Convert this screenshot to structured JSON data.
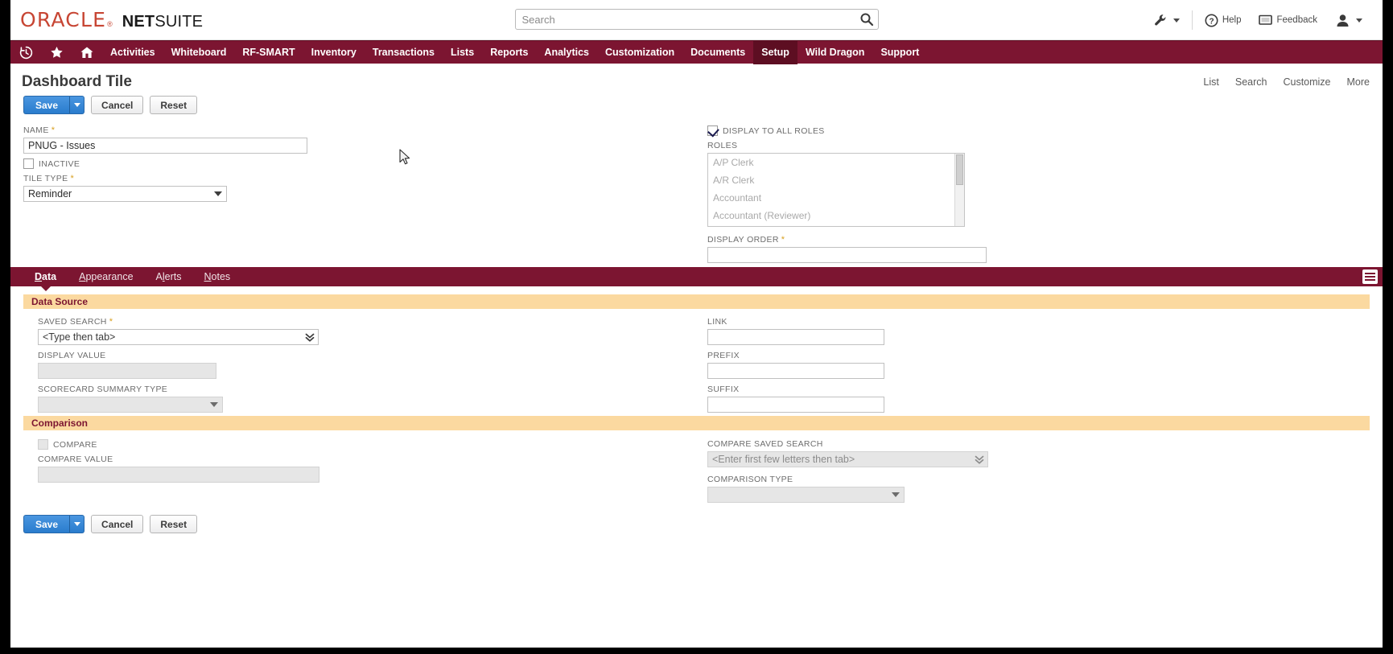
{
  "brand": {
    "oracle": "ORACLE",
    "netsuite_bold": "NET",
    "netsuite_light": "SUITE"
  },
  "search": {
    "placeholder": "Search",
    "value": "",
    "icon": "search-icon"
  },
  "topbar_right": {
    "settings_icon": "wrench-settings-icon",
    "help_label": "Help",
    "help_icon": "question-circle-icon",
    "feedback_label": "Feedback",
    "feedback_icon": "speech-bubble-icon",
    "avatar_icon": "user-avatar-icon"
  },
  "nav": {
    "icons": [
      "recent-records-icon",
      "shortcuts-star-icon",
      "home-icon"
    ],
    "items": [
      {
        "label": "Activities",
        "active": false
      },
      {
        "label": "Whiteboard",
        "active": false
      },
      {
        "label": "RF-SMART",
        "active": false
      },
      {
        "label": "Inventory",
        "active": false
      },
      {
        "label": "Transactions",
        "active": false
      },
      {
        "label": "Lists",
        "active": false
      },
      {
        "label": "Reports",
        "active": false
      },
      {
        "label": "Analytics",
        "active": false
      },
      {
        "label": "Customization",
        "active": false
      },
      {
        "label": "Documents",
        "active": false
      },
      {
        "label": "Setup",
        "active": true
      },
      {
        "label": "Wild Dragon",
        "active": false
      },
      {
        "label": "Support",
        "active": false
      }
    ]
  },
  "page": {
    "title": "Dashboard Tile",
    "links": [
      "List",
      "Search",
      "Customize",
      "More"
    ]
  },
  "buttons": {
    "save": "Save",
    "cancel": "Cancel",
    "reset": "Reset"
  },
  "form": {
    "name_label": "NAME",
    "name_value": "PNUG - Issues",
    "inactive_label": "INACTIVE",
    "inactive_checked": false,
    "tile_type_label": "TILE TYPE",
    "tile_type_value": "Reminder",
    "display_all_roles_label": "DISPLAY TO ALL ROLES",
    "display_all_roles_checked": true,
    "roles_label": "ROLES",
    "roles": [
      "A/P Clerk",
      "A/R Clerk",
      "Accountant",
      "Accountant (Reviewer)"
    ],
    "display_order_label": "DISPLAY ORDER",
    "display_order_value": ""
  },
  "tabs": [
    {
      "label": "Data",
      "accesskey": "D",
      "active": true
    },
    {
      "label": "Appearance",
      "accesskey": "A",
      "active": false
    },
    {
      "label": "Alerts",
      "accesskey": "l",
      "active": false
    },
    {
      "label": "Notes",
      "accesskey": "N",
      "active": false
    }
  ],
  "data_source": {
    "header": "Data Source",
    "saved_search_label": "SAVED SEARCH",
    "saved_search_placeholder": "<Type then tab>",
    "saved_search_value": "",
    "display_value_label": "DISPLAY VALUE",
    "display_value": "",
    "scorecard_summary_label": "SCORECARD SUMMARY TYPE",
    "scorecard_summary_value": "",
    "link_label": "LINK",
    "link_value": "",
    "prefix_label": "PREFIX",
    "prefix_value": "",
    "suffix_label": "SUFFIX",
    "suffix_value": ""
  },
  "comparison": {
    "header": "Comparison",
    "compare_label": "COMPARE",
    "compare_checked": false,
    "compare_value_label": "COMPARE VALUE",
    "compare_value": "",
    "compare_saved_search_label": "COMPARE SAVED SEARCH",
    "compare_saved_search_placeholder": "<Enter first few letters then tab>",
    "compare_saved_search_value": "",
    "comparison_type_label": "COMPARISON TYPE",
    "comparison_type_value": ""
  },
  "colors": {
    "brand_maroon": "#7c1531",
    "oracle_red": "#c74634",
    "section_header_bg": "#fbd9a0",
    "primary_button": "#2a7ccd",
    "required_asterisk": "#d8a020"
  }
}
